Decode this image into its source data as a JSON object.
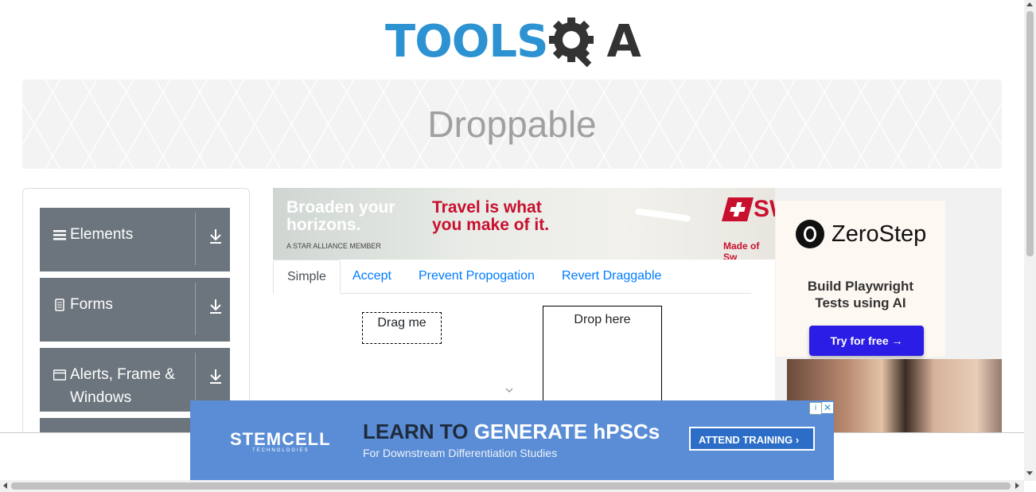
{
  "header": {
    "logo_left": "TOOLS",
    "logo_right": "A"
  },
  "page": {
    "title": "Droppable"
  },
  "sidebar": {
    "groups": [
      {
        "label": "Elements",
        "icon": "hamburger-icon"
      },
      {
        "label": "Forms",
        "icon": "document-icon"
      },
      {
        "label": "Alerts, Frame &",
        "label2": "Windows",
        "icon": "window-icon"
      }
    ]
  },
  "top_ad": {
    "line1": "Broaden your",
    "line2": "horizons.",
    "slogan1": "Travel is what",
    "slogan2": "you make of it.",
    "alliance": "A STAR ALLIANCE MEMBER",
    "brand": "SW",
    "made": "Made of Sw"
  },
  "tabs": [
    {
      "label": "Simple",
      "active": true
    },
    {
      "label": "Accept",
      "active": false
    },
    {
      "label": "Prevent Propogation",
      "active": false
    },
    {
      "label": "Revert Draggable",
      "active": false
    }
  ],
  "draggable": {
    "label": "Drag me"
  },
  "droppable": {
    "label": "Drop here"
  },
  "right_ad": {
    "brand": "ZeroStep",
    "tagline1": "Build Playwright",
    "tagline2": "Tests using AI",
    "cta": "Try for free →"
  },
  "bottom_ad": {
    "brand": "STEMCELL",
    "brand_sub": "TECHNOLOGIES",
    "headline_dark": "LEARN TO",
    "headline": "GENERATE hPSCs",
    "sub": "For Downstream Differentiation Studies",
    "cta": "ATTEND TRAINING",
    "close": "✕",
    "info": "i"
  },
  "colors": {
    "accent": "#2c92d2",
    "sidebar": "#6c757d",
    "link": "#007bff"
  }
}
